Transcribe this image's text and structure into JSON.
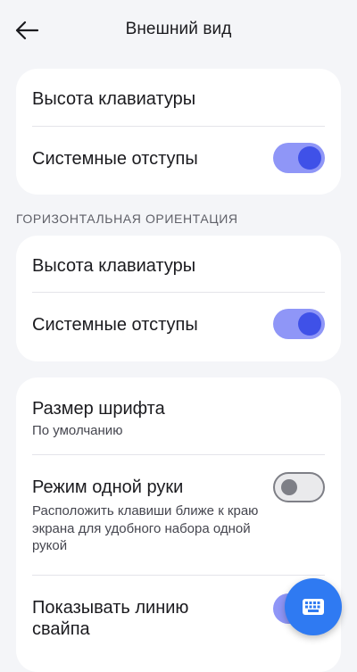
{
  "header": {
    "title": "Внешний вид",
    "back_icon": "arrow-left-icon"
  },
  "card_portrait": {
    "keyboard_height": "Высота клавиатуры",
    "system_insets": "Системные отступы",
    "system_insets_enabled": true
  },
  "landscape_section": {
    "header": "ГОРИЗОНТАЛЬНАЯ ОРИЕНТАЦИЯ",
    "keyboard_height": "Высота клавиатуры",
    "system_insets": "Системные отступы",
    "system_insets_enabled": true
  },
  "card_misc": {
    "font_size": {
      "title": "Размер шрифта",
      "value": "По умолчанию"
    },
    "one_hand": {
      "title": "Режим одной руки",
      "description": "Расположить клавиши ближе к краю экрана для удобного набора одной рукой",
      "enabled": false
    },
    "swipe_line": {
      "title": "Показывать линию свайпа",
      "enabled": true
    }
  },
  "fab": {
    "icon": "keyboard-icon"
  },
  "colors": {
    "accent": "#3f51e8",
    "accent_track": "#8f96f7",
    "fab": "#2f7af2",
    "background": "#f4f5f8",
    "card": "#ffffff"
  }
}
